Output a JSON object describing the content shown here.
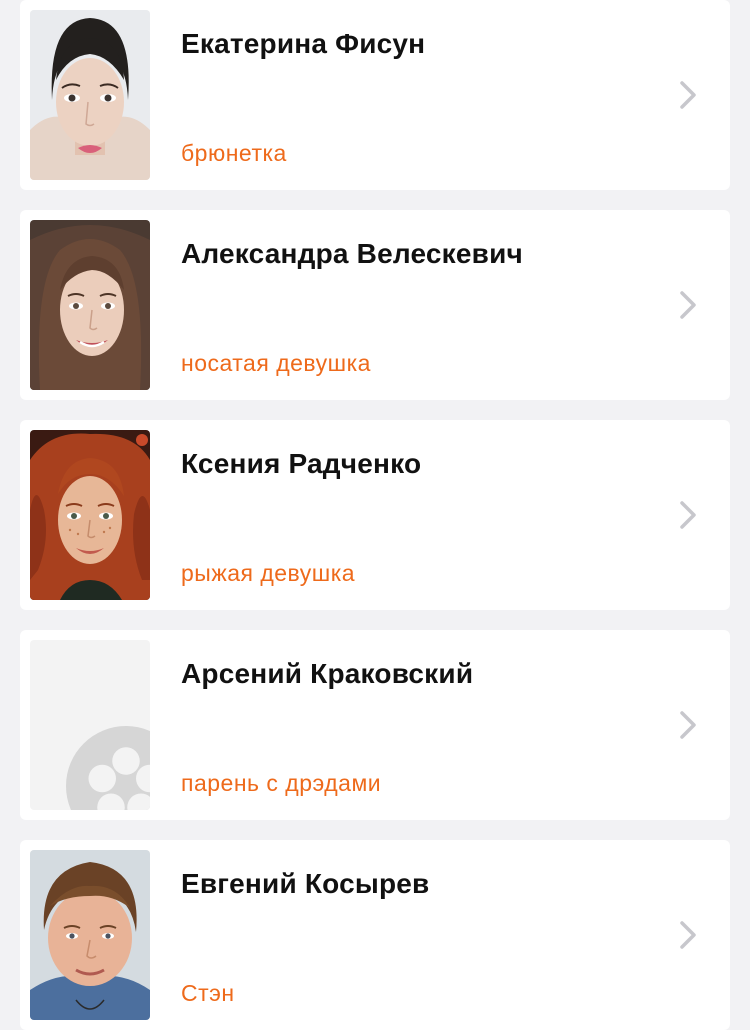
{
  "cast": [
    {
      "name": "Екатерина Фисун",
      "role": "брюнетка",
      "photo": "photo-dark-hair-woman"
    },
    {
      "name": "Александра Велескевич",
      "role": "носатая девушка",
      "photo": "photo-long-brown-hair-woman"
    },
    {
      "name": "Ксения Радченко",
      "role": "рыжая девушка",
      "photo": "photo-red-curly-hair-woman"
    },
    {
      "name": "Арсений Краковский",
      "role": "парень с дрэдами",
      "photo": "film-reel-placeholder-icon"
    },
    {
      "name": "Евгений Косырев",
      "role": "Стэн",
      "photo": "photo-man-round-face"
    }
  ],
  "colors": {
    "background": "#f2f2f4",
    "card": "#ffffff",
    "name_text": "#111111",
    "role_text": "#ee6a1b",
    "chevron": "#c7c7cc",
    "placeholder": "#f3f3f3"
  },
  "icons": {
    "chevron": "chevron-right-icon",
    "placeholder": "film-reel-icon"
  }
}
